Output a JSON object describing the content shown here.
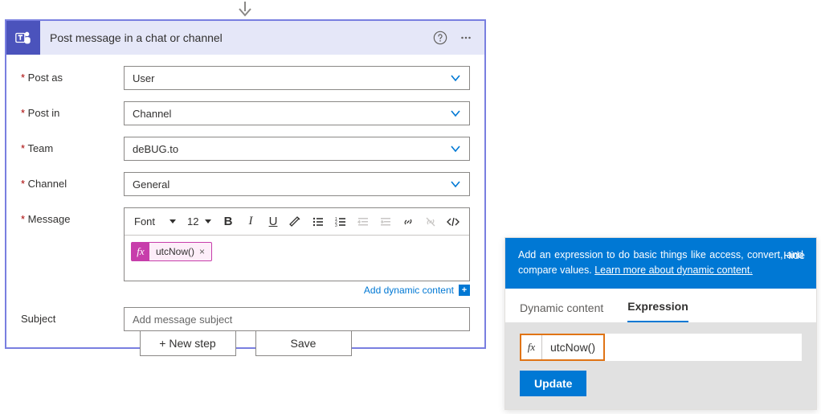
{
  "card": {
    "title": "Post message in a chat or channel",
    "fields": {
      "post_as": {
        "label": "Post as",
        "value": "User"
      },
      "post_in": {
        "label": "Post in",
        "value": "Channel"
      },
      "team": {
        "label": "Team",
        "value": "deBUG.to"
      },
      "channel": {
        "label": "Channel",
        "value": "General"
      },
      "message": {
        "label": "Message"
      },
      "subject": {
        "label": "Subject",
        "placeholder": "Add message subject"
      }
    },
    "rte": {
      "font_label": "Font",
      "size_label": "12",
      "token": {
        "fx": "fx",
        "text": "utcNow()"
      }
    },
    "dyn_link": "Add dynamic content"
  },
  "footer": {
    "new_step": "+ New step",
    "save": "Save"
  },
  "panel": {
    "hint_prefix": "Add an expression to do basic things like access, convert, and compare values. ",
    "hint_link": "Learn more about dynamic content.",
    "hide": "Hide",
    "tabs": {
      "dynamic": "Dynamic content",
      "expression": "Expression"
    },
    "fx": "fx",
    "input": "utcNow()",
    "update": "Update"
  }
}
